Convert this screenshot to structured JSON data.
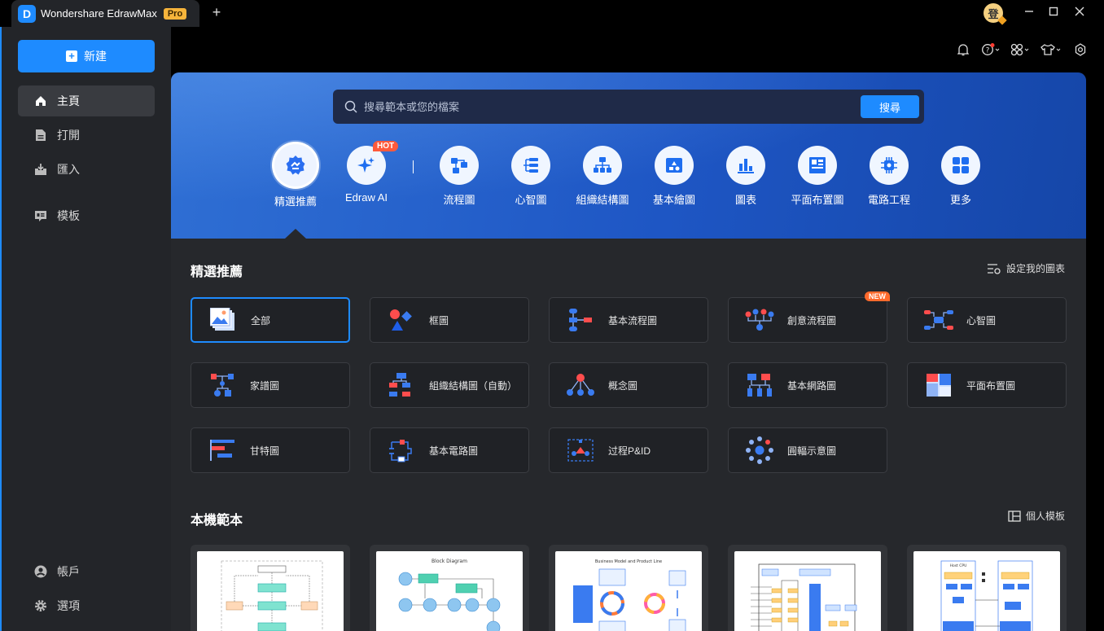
{
  "app": {
    "logo": "D",
    "name": "Wondershare EdrawMax",
    "badge": "Pro",
    "newtab": "+",
    "avatar": "登"
  },
  "sidebar": {
    "new_label": "新建",
    "items": [
      {
        "label": "主頁",
        "icon": "home-icon"
      },
      {
        "label": "打開",
        "icon": "file-icon"
      },
      {
        "label": "匯入",
        "icon": "import-icon"
      },
      {
        "label": "模板",
        "icon": "template-icon"
      }
    ],
    "bottom": [
      {
        "label": "帳戶",
        "icon": "account-icon"
      },
      {
        "label": "選項",
        "icon": "settings-icon"
      }
    ]
  },
  "search": {
    "placeholder": "搜尋範本或您的檔案",
    "button": "搜尋"
  },
  "categories": [
    {
      "label": "精選推薦",
      "icon": "featured-icon"
    },
    {
      "label": "Edraw AI",
      "icon": "ai-sparkle-icon",
      "badge": "HOT"
    },
    {
      "label": "流程圖",
      "icon": "flowchart-icon"
    },
    {
      "label": "心智圖",
      "icon": "mindmap-icon"
    },
    {
      "label": "組織結構圖",
      "icon": "orgchart-icon"
    },
    {
      "label": "基本繪圖",
      "icon": "basic-drawing-icon"
    },
    {
      "label": "圖表",
      "icon": "chart-icon"
    },
    {
      "label": "平面布置圖",
      "icon": "floorplan-icon"
    },
    {
      "label": "電路工程",
      "icon": "circuit-icon"
    },
    {
      "label": "更多",
      "icon": "more-grid-icon"
    }
  ],
  "featured": {
    "title": "精選推薦",
    "settings_link": "設定我的圖表",
    "cards": [
      {
        "label": "全部"
      },
      {
        "label": "框圖"
      },
      {
        "label": "基本流程圖"
      },
      {
        "label": "創意流程圖",
        "badge": "NEW"
      },
      {
        "label": "心智圖"
      },
      {
        "label": "家譜圖"
      },
      {
        "label": "組織結構圖（自動）"
      },
      {
        "label": "概念圖"
      },
      {
        "label": "基本網路圖"
      },
      {
        "label": "平面布置圖"
      },
      {
        "label": "甘特圖"
      },
      {
        "label": "基本電路圖"
      },
      {
        "label": "过程P&ID"
      },
      {
        "label": "圓輻示意圖"
      }
    ]
  },
  "local": {
    "title": "本機範本",
    "personal_link": "個人模板",
    "thumbs": [
      "",
      "Block Diagram",
      "Business Model and Product Line",
      "",
      "Host CPU"
    ]
  }
}
